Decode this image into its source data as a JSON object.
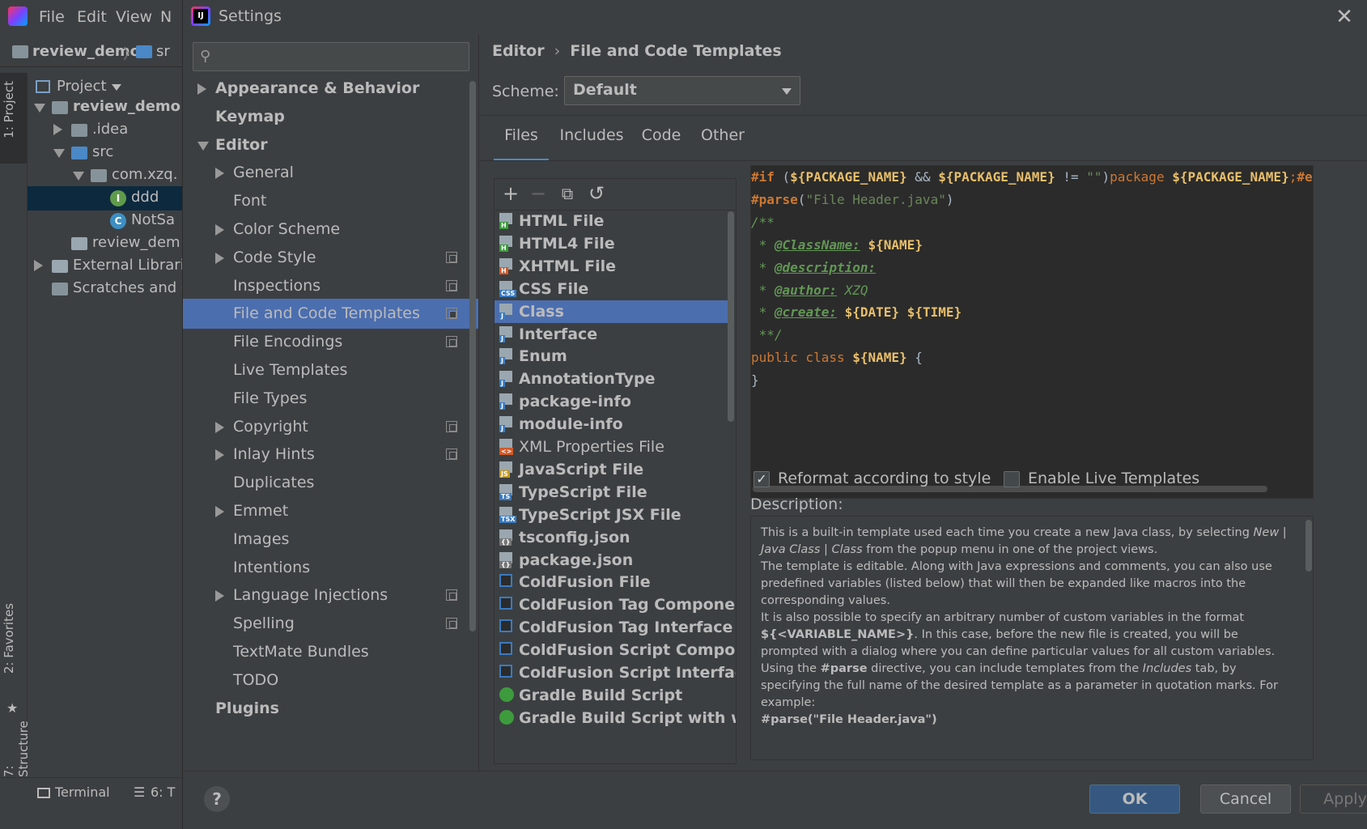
{
  "ide": {
    "menu": [
      "File",
      "Edit",
      "View",
      "N"
    ],
    "breadcrumb": [
      "review_demo",
      "sr"
    ],
    "project_view_label": "Project",
    "tree": [
      {
        "label": "review_demo",
        "level": 0,
        "state": "expanded",
        "icon": "module-folder-icon"
      },
      {
        "label": ".idea",
        "level": 1,
        "state": "collapsed",
        "icon": "folder-icon"
      },
      {
        "label": "src",
        "level": 1,
        "state": "expanded",
        "icon": "source-folder-icon"
      },
      {
        "label": "com.xzq.",
        "level": 2,
        "state": "expanded",
        "icon": "package-icon"
      },
      {
        "label": "ddd",
        "level": 3,
        "state": "leaf",
        "icon": "interface-icon"
      },
      {
        "label": "NotSa",
        "level": 3,
        "state": "leaf",
        "icon": "class-icon"
      },
      {
        "label": "review_dem",
        "level": 1,
        "state": "leaf",
        "icon": "iml-file-icon"
      },
      {
        "label": "External Librari",
        "level": 0,
        "state": "collapsed",
        "icon": "libraries-icon"
      },
      {
        "label": "Scratches and C",
        "level": 0,
        "state": "leaf",
        "icon": "scratches-icon"
      }
    ],
    "side_tabs": [
      "1: Project",
      "2: Favorites",
      "7: Structure"
    ],
    "bottom_tabs": [
      "Terminal",
      "6: T"
    ]
  },
  "dialog": {
    "title": "Settings",
    "close_glyph": "✕",
    "nav": [
      {
        "label": "Appearance & Behavior",
        "level": 0,
        "bold": true,
        "arrow": "right",
        "page_icon": false
      },
      {
        "label": "Keymap",
        "level": 0,
        "bold": true,
        "arrow": "none",
        "page_icon": false
      },
      {
        "label": "Editor",
        "level": 0,
        "bold": true,
        "arrow": "down",
        "page_icon": false
      },
      {
        "label": "General",
        "level": 1,
        "bold": false,
        "arrow": "right",
        "page_icon": false
      },
      {
        "label": "Font",
        "level": 1,
        "bold": false,
        "arrow": "none",
        "page_icon": false
      },
      {
        "label": "Color Scheme",
        "level": 1,
        "bold": false,
        "arrow": "right",
        "page_icon": false
      },
      {
        "label": "Code Style",
        "level": 1,
        "bold": false,
        "arrow": "right",
        "page_icon": true
      },
      {
        "label": "Inspections",
        "level": 1,
        "bold": false,
        "arrow": "none",
        "page_icon": true
      },
      {
        "label": "File and Code Templates",
        "level": 1,
        "bold": false,
        "arrow": "none",
        "page_icon": true,
        "selected": true
      },
      {
        "label": "File Encodings",
        "level": 1,
        "bold": false,
        "arrow": "none",
        "page_icon": true
      },
      {
        "label": "Live Templates",
        "level": 1,
        "bold": false,
        "arrow": "none",
        "page_icon": false
      },
      {
        "label": "File Types",
        "level": 1,
        "bold": false,
        "arrow": "none",
        "page_icon": false
      },
      {
        "label": "Copyright",
        "level": 1,
        "bold": false,
        "arrow": "right",
        "page_icon": true
      },
      {
        "label": "Inlay Hints",
        "level": 1,
        "bold": false,
        "arrow": "right",
        "page_icon": true
      },
      {
        "label": "Duplicates",
        "level": 1,
        "bold": false,
        "arrow": "none",
        "page_icon": false
      },
      {
        "label": "Emmet",
        "level": 1,
        "bold": false,
        "arrow": "right",
        "page_icon": false
      },
      {
        "label": "Images",
        "level": 1,
        "bold": false,
        "arrow": "none",
        "page_icon": false
      },
      {
        "label": "Intentions",
        "level": 1,
        "bold": false,
        "arrow": "none",
        "page_icon": false
      },
      {
        "label": "Language Injections",
        "level": 1,
        "bold": false,
        "arrow": "right",
        "page_icon": true
      },
      {
        "label": "Spelling",
        "level": 1,
        "bold": false,
        "arrow": "none",
        "page_icon": true
      },
      {
        "label": "TextMate Bundles",
        "level": 1,
        "bold": false,
        "arrow": "none",
        "page_icon": false
      },
      {
        "label": "TODO",
        "level": 1,
        "bold": false,
        "arrow": "none",
        "page_icon": false
      },
      {
        "label": "Plugins",
        "level": 0,
        "bold": true,
        "arrow": "none",
        "page_icon": false
      }
    ],
    "breadcrumb": [
      "Editor",
      "File and Code Templates"
    ],
    "scheme": {
      "label": "Scheme:",
      "value": "Default"
    },
    "tabs": [
      {
        "label": "Files",
        "active": true
      },
      {
        "label": "Includes",
        "active": false
      },
      {
        "label": "Code",
        "active": false
      },
      {
        "label": "Other",
        "active": false
      }
    ],
    "toolbar": {
      "add": "+",
      "remove": "−",
      "copy": "⧉",
      "reset": "↺"
    },
    "templates": [
      {
        "label": "HTML File",
        "icon": "html-file-icon",
        "tag": "H",
        "color": "#3d9b3d",
        "bold": true
      },
      {
        "label": "HTML4 File",
        "icon": "html4-file-icon",
        "tag": "H",
        "color": "#3d9b3d",
        "bold": true
      },
      {
        "label": "XHTML File",
        "icon": "xhtml-file-icon",
        "tag": "H",
        "color": "#d15a2b",
        "bold": true
      },
      {
        "label": "CSS File",
        "icon": "css-file-icon",
        "tag": "CSS",
        "color": "#3a7abf",
        "bold": true
      },
      {
        "label": "Class",
        "icon": "java-class-file-icon",
        "tag": "J",
        "color": "#3a7abf",
        "bold": true,
        "selected": true
      },
      {
        "label": "Interface",
        "icon": "java-interface-file-icon",
        "tag": "J",
        "color": "#3a7abf",
        "bold": true
      },
      {
        "label": "Enum",
        "icon": "java-enum-file-icon",
        "tag": "J",
        "color": "#3a7abf",
        "bold": true
      },
      {
        "label": "AnnotationType",
        "icon": "java-annotation-file-icon",
        "tag": "J",
        "color": "#3a7abf",
        "bold": true
      },
      {
        "label": "package-info",
        "icon": "java-file-icon",
        "tag": "J",
        "color": "#3a7abf",
        "bold": true
      },
      {
        "label": "module-info",
        "icon": "java-file-icon",
        "tag": "J",
        "color": "#3a7abf",
        "bold": true
      },
      {
        "label": "XML Properties File",
        "icon": "xml-file-icon",
        "tag": "<>",
        "color": "#d15a2b",
        "bold": false
      },
      {
        "label": "JavaScript File",
        "icon": "javascript-file-icon",
        "tag": "JS",
        "color": "#c49a25",
        "bold": true
      },
      {
        "label": "TypeScript File",
        "icon": "typescript-file-icon",
        "tag": "TS",
        "color": "#3a7abf",
        "bold": true
      },
      {
        "label": "TypeScript JSX File",
        "icon": "tsx-file-icon",
        "tag": "TSX",
        "color": "#3a7abf",
        "bold": true
      },
      {
        "label": "tsconfig.json",
        "icon": "json-file-icon",
        "tag": "{}",
        "color": "#777777",
        "bold": true
      },
      {
        "label": "package.json",
        "icon": "json-file-icon",
        "tag": "{}",
        "color": "#777777",
        "bold": true
      },
      {
        "label": "ColdFusion File",
        "icon": "coldfusion-file-icon",
        "tag": "Cf",
        "color": "#3a7abf",
        "bold": true
      },
      {
        "label": "ColdFusion Tag Component",
        "icon": "coldfusion-file-icon",
        "tag": "Cf",
        "color": "#3a7abf",
        "bold": true
      },
      {
        "label": "ColdFusion Tag Interface",
        "icon": "coldfusion-file-icon",
        "tag": "Cf",
        "color": "#3a7abf",
        "bold": true
      },
      {
        "label": "ColdFusion Script Component",
        "icon": "coldfusion-file-icon",
        "tag": "Cf",
        "color": "#3a7abf",
        "bold": true
      },
      {
        "label": "ColdFusion Script Interface",
        "icon": "coldfusion-file-icon",
        "tag": "Cf",
        "color": "#3a7abf",
        "bold": true
      },
      {
        "label": "Gradle Build Script",
        "icon": "gradle-icon",
        "tag": "G",
        "color": "#3d9b3d",
        "bold": true
      },
      {
        "label": "Gradle Build Script with wrappe",
        "icon": "gradle-icon",
        "tag": "G",
        "color": "#3d9b3d",
        "bold": true
      }
    ],
    "editor_lines": [
      [
        {
          "t": "#if",
          "c": "dir"
        },
        {
          "t": " (",
          "c": "txt"
        },
        {
          "t": "${PACKAGE_NAME}",
          "c": "var"
        },
        {
          "t": " && ",
          "c": "txt"
        },
        {
          "t": "${PACKAGE_NAME}",
          "c": "var"
        },
        {
          "t": " != ",
          "c": "txt"
        },
        {
          "t": "\"\"",
          "c": "str"
        },
        {
          "t": ")",
          "c": "txt"
        },
        {
          "t": "package ",
          "c": "kw"
        },
        {
          "t": "${PACKAGE_NAME}",
          "c": "var"
        },
        {
          "t": ";",
          "c": "kw"
        },
        {
          "t": "#end",
          "c": "dir"
        }
      ],
      [
        {
          "t": "#parse",
          "c": "dir"
        },
        {
          "t": "(",
          "c": "txt"
        },
        {
          "t": "\"File Header.java\"",
          "c": "str"
        },
        {
          "t": ")",
          "c": "txt"
        }
      ],
      [
        {
          "t": "/**",
          "c": "cmt"
        }
      ],
      [
        {
          "t": " * ",
          "c": "cmt"
        },
        {
          "t": "@ClassName:",
          "c": "tagc"
        },
        {
          "t": " ",
          "c": "cmt"
        },
        {
          "t": "${NAME}",
          "c": "var"
        }
      ],
      [
        {
          "t": " * ",
          "c": "cmt"
        },
        {
          "t": "@description:",
          "c": "tagc"
        }
      ],
      [
        {
          "t": " * ",
          "c": "cmt"
        },
        {
          "t": "@author:",
          "c": "tagc"
        },
        {
          "t": " XZQ",
          "c": "cmt"
        }
      ],
      [
        {
          "t": " * ",
          "c": "cmt"
        },
        {
          "t": "@create:",
          "c": "tagc"
        },
        {
          "t": " ",
          "c": "cmt"
        },
        {
          "t": "${DATE}",
          "c": "var"
        },
        {
          "t": " ",
          "c": "cmt"
        },
        {
          "t": "${TIME}",
          "c": "var"
        }
      ],
      [
        {
          "t": " **/",
          "c": "cmt"
        }
      ],
      [
        {
          "t": "public class ",
          "c": "kw"
        },
        {
          "t": "${NAME}",
          "c": "var"
        },
        {
          "t": " {",
          "c": "txt"
        }
      ],
      [
        {
          "t": "}",
          "c": "txt"
        }
      ]
    ],
    "reformat": {
      "label": "Reformat according to style",
      "checked": true
    },
    "live_templates": {
      "label": "Enable Live Templates",
      "checked": false
    },
    "description_label": "Description:",
    "description": [
      {
        "t": "This is a built-in template used each time you create a new Java class, by selecting "
      },
      {
        "t": "New | Java Class | Class",
        "s": "i"
      },
      {
        "t": " from the popup menu in one of the project views."
      },
      {
        "br": true
      },
      {
        "t": "The template is editable. Along with Java expressions and comments, you can also use predefined variables (listed below) that will then be expanded like macros into the corresponding values."
      },
      {
        "br": true
      },
      {
        "t": "It is also possible to specify an arbitrary number of custom variables in the format "
      },
      {
        "t": "${<VARIABLE_NAME>}",
        "s": "b"
      },
      {
        "t": ". In this case, before the new file is created, you will be prompted with a dialog where you can define particular values for all custom variables."
      },
      {
        "br": true
      },
      {
        "t": "Using the "
      },
      {
        "t": "#parse",
        "s": "b"
      },
      {
        "t": " directive, you can include templates from the "
      },
      {
        "t": "Includes",
        "s": "i"
      },
      {
        "t": " tab, by specifying the full name of the desired template as a parameter in quotation marks. For example:"
      },
      {
        "br": true
      },
      {
        "t": "#parse(\"File Header.java\")",
        "s": "b"
      }
    ],
    "buttons": {
      "help": "?",
      "ok": "OK",
      "cancel": "Cancel",
      "apply": "Apply"
    }
  }
}
